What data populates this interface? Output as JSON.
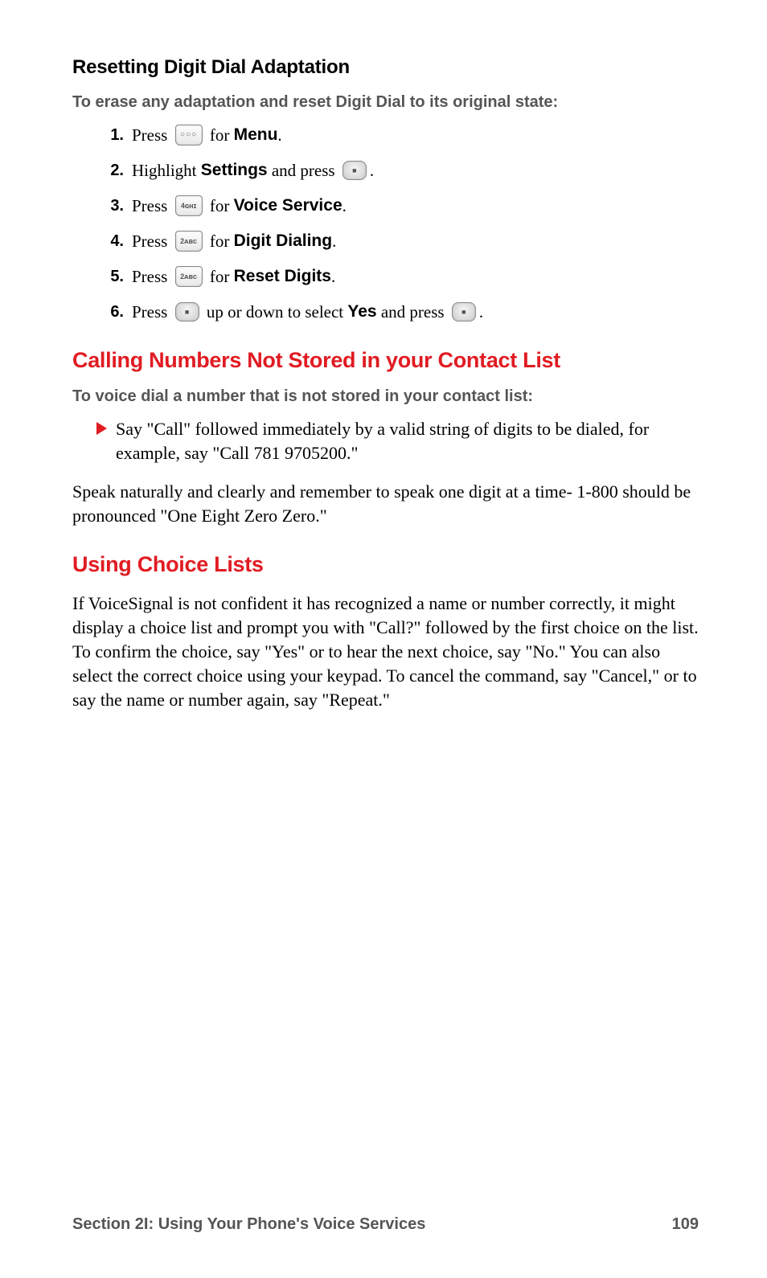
{
  "heading_reset": "Resetting Digit Dial Adaptation",
  "intro_reset": "To erase any adaptation and reset Digit Dial to its original state:",
  "steps": [
    {
      "n": "1.",
      "pre": "Press ",
      "key": "menu-key",
      "mid": " for ",
      "bold": "Menu",
      "post": "."
    },
    {
      "n": "2.",
      "pre": "Highlight ",
      "bold1": "Settings",
      "mid": " and press ",
      "key": "ok-key",
      "post": "."
    },
    {
      "n": "3.",
      "pre": "Press ",
      "key": "4ghi-key",
      "mid": " for ",
      "bold": "Voice Service",
      "post": "."
    },
    {
      "n": "4.",
      "pre": "Press ",
      "key": "2abc-key",
      "mid": " for ",
      "bold": "Digit Dialing",
      "post": "."
    },
    {
      "n": "5.",
      "pre": "Press ",
      "key": "2abc-key",
      "mid": " for ",
      "bold": "Reset Digits",
      "post": "."
    },
    {
      "n": "6.",
      "pre": "Press ",
      "key": "ok-key",
      "mid": " up or down to select ",
      "bold": "Yes",
      "mid2": " and press ",
      "key2": "ok-key",
      "post": "."
    }
  ],
  "icons": {
    "menu-key": "○○○",
    "ok-key": "■",
    "4ghi-key": "4ɢʜɪ",
    "2abc-key": "2ᴀʙᴄ"
  },
  "heading_calling": "Calling Numbers Not Stored in your Contact List",
  "intro_calling": "To voice dial a number that is not stored in your contact list:",
  "bullet_call": "Say \"Call\" followed immediately by a valid string of digits to be dialed, for example, say \"Call 781 9705200.\"",
  "para_speak": "Speak naturally and clearly and remember to speak one digit at a time- 1-800 should be pronounced \"One Eight Zero Zero.\"",
  "heading_choice": "Using Choice Lists",
  "para_choice": "If VoiceSignal is not confident it has recognized a name or number correctly, it might display a choice list and prompt you with \"Call?\" followed by the first choice on the list. To confirm the choice, say \"Yes\" or to hear the next choice, say \"No.\" You can also select the correct choice using your keypad. To cancel the command, say \"Cancel,\" or to say the name or number again, say \"Repeat.\"",
  "footer_left": "Section 2I: Using Your Phone's Voice Services",
  "footer_right": "109"
}
